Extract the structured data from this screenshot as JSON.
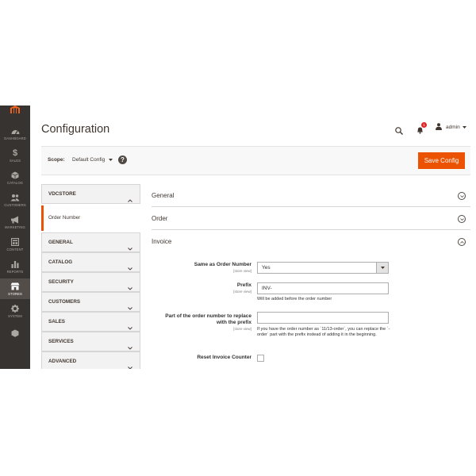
{
  "nav": {
    "items": [
      {
        "label": "DASHBOARD",
        "icon": "dashboard-icon"
      },
      {
        "label": "SALES",
        "icon": "dollar-icon"
      },
      {
        "label": "CATALOG",
        "icon": "cube-icon"
      },
      {
        "label": "CUSTOMERS",
        "icon": "users-icon"
      },
      {
        "label": "MARKETING",
        "icon": "megaphone-icon"
      },
      {
        "label": "CONTENT",
        "icon": "layout-icon"
      },
      {
        "label": "REPORTS",
        "icon": "bar-chart-icon"
      },
      {
        "label": "STORES",
        "icon": "store-icon"
      },
      {
        "label": "SYSTEM",
        "icon": "gear-icon"
      }
    ]
  },
  "header": {
    "title": "Configuration",
    "notification_count": "1",
    "user": "admin"
  },
  "scope": {
    "label": "Scope:",
    "value": "Default Config",
    "help": "?"
  },
  "toolbar": {
    "save_label": "Save Config"
  },
  "tabs": {
    "group_vdcstore": "VDCSTORE",
    "vdcstore_item": "Order Number",
    "groups": [
      "GENERAL",
      "CATALOG",
      "SECURITY",
      "CUSTOMERS",
      "SALES",
      "SERVICES",
      "ADVANCED"
    ]
  },
  "sections": {
    "general": "General",
    "order": "Order",
    "invoice": "Invoice"
  },
  "invoice_form": {
    "same_as_order_label": "Same as Order Number",
    "same_as_order_scope": "[store view]",
    "same_as_order_value": "Yes",
    "prefix_label": "Prefix",
    "prefix_scope": "[store view]",
    "prefix_value": "INV-",
    "prefix_note": "Will be added before the order number",
    "replace_label_1": "Part of the order number to replace",
    "replace_label_2": "with the prefix",
    "replace_scope": "[store view]",
    "replace_value": "",
    "replace_note": "If you have the order number as `11/13-order`, you can replace the `-order` part with the prefix instead of adding it in the beginning.",
    "reset_label": "Reset Invoice Counter"
  },
  "colors": {
    "accent": "#eb5202",
    "nav_bg": "#373330"
  }
}
